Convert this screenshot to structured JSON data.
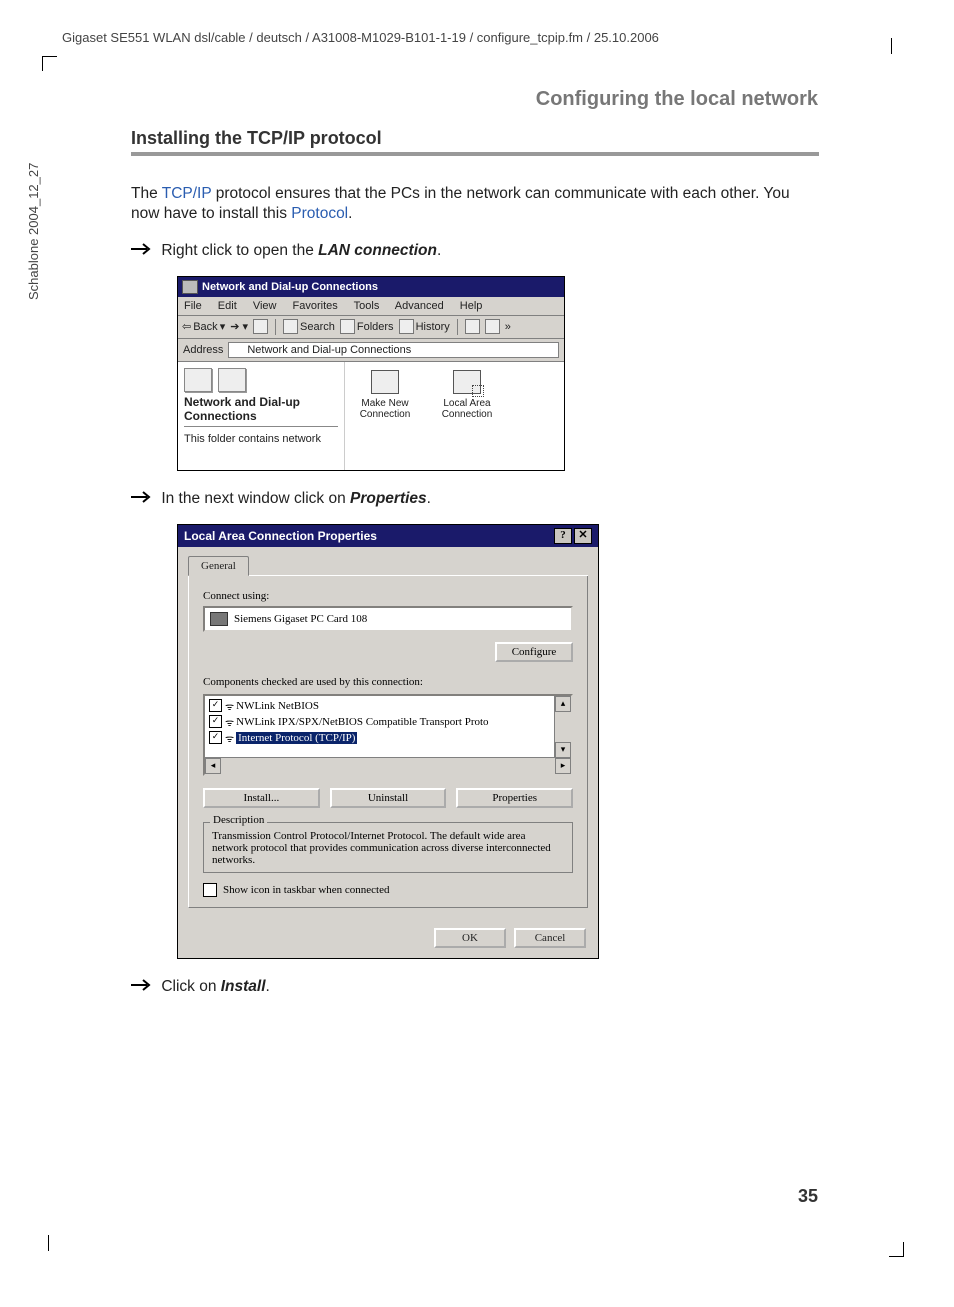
{
  "header_path": "Gigaset SE551 WLAN dsl/cable / deutsch / A31008-M1029-B101-1-19 / configure_tcpip.fm / 25.10.2006",
  "side_text": "Schablone 2004_12_27",
  "chapter_title": "Configuring the local network",
  "section_title": "Installing the TCP/IP protocol",
  "intro": {
    "pre1": "The ",
    "link1": "TCP/IP",
    "mid1": " protocol ensures that the PCs in the network can communicate with each other. You now have to install this ",
    "link2": "Protocol",
    "post": "."
  },
  "steps": {
    "s1_pre": "Right click to open the ",
    "s1_bold": "LAN connection",
    "s1_post": ".",
    "s2_pre": "In the next window click on ",
    "s2_bold": "Properties",
    "s2_post": ".",
    "s3_pre": "Click on ",
    "s3_bold": "Install",
    "s3_post": "."
  },
  "fig1": {
    "title": "Network and Dial-up Connections",
    "menu": {
      "file": "File",
      "edit": "Edit",
      "view": "View",
      "fav": "Favorites",
      "tools": "Tools",
      "adv": "Advanced",
      "help": "Help"
    },
    "toolbar": {
      "back": "Back",
      "search": "Search",
      "folders": "Folders",
      "history": "History"
    },
    "address_label": "Address",
    "address_value": "Network and Dial-up Connections",
    "left_title": "Network and Dial-up Connections",
    "left_desc": "This folder contains network",
    "items": {
      "make": "Make New Connection",
      "lac": "Local Area Connection"
    }
  },
  "fig2": {
    "title": "Local Area Connection Properties",
    "tab": "General",
    "connect_using": "Connect using:",
    "card": "Siemens Gigaset PC Card 108",
    "configure": "Configure",
    "components_label": "Components checked are used by this connection:",
    "comps": {
      "c1": "NWLink NetBIOS",
      "c2": "NWLink IPX/SPX/NetBIOS Compatible Transport Proto",
      "c3": "Internet Protocol (TCP/IP)"
    },
    "install": "Install...",
    "uninstall": "Uninstall",
    "properties": "Properties",
    "desc_title": "Description",
    "desc_text": "Transmission Control Protocol/Internet Protocol. The default wide area network protocol that provides communication across diverse interconnected networks.",
    "show_icon": "Show icon in taskbar when connected",
    "ok": "OK",
    "cancel": "Cancel"
  },
  "page_number": "35"
}
